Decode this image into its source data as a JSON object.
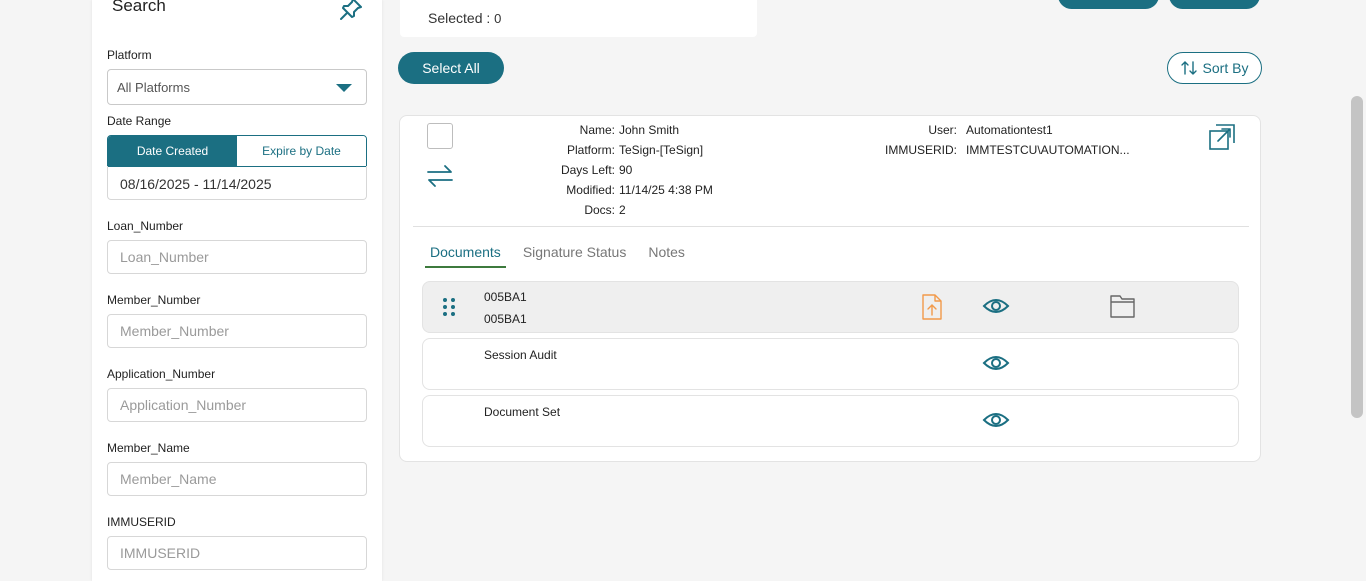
{
  "sidebar": {
    "title": "Search",
    "platform": {
      "label": "Platform",
      "value": "All Platforms"
    },
    "date_range": {
      "label": "Date Range",
      "options": [
        "Date Created",
        "Expire by Date"
      ],
      "value": "08/16/2025 - 11/14/2025"
    },
    "fields": [
      {
        "label": "Loan_Number",
        "placeholder": "Loan_Number"
      },
      {
        "label": "Member_Number",
        "placeholder": "Member_Number"
      },
      {
        "label": "Application_Number",
        "placeholder": "Application_Number"
      },
      {
        "label": "Member_Name",
        "placeholder": "Member_Name"
      },
      {
        "label": "IMMUSERID",
        "placeholder": "IMMUSERID"
      }
    ]
  },
  "selection": {
    "label": "Selected : ",
    "count": "0"
  },
  "toolbar": {
    "select_all": "Select All",
    "sort_by": "Sort By"
  },
  "record": {
    "left": [
      {
        "label": "Name:",
        "value": "John Smith"
      },
      {
        "label": "Platform:",
        "value": "TeSign-[TeSign]"
      },
      {
        "label": "Days Left:",
        "value": "90"
      },
      {
        "label": "Modified:",
        "value": "11/14/25 4:38 PM"
      },
      {
        "label": "Docs:",
        "value": "2"
      }
    ],
    "right": [
      {
        "label": "User:",
        "value": "Automationtest1"
      },
      {
        "label": "IMMUSERID:",
        "value": "IMMTESTCU\\AUTOMATION..."
      }
    ],
    "tabs": [
      "Documents",
      "Signature Status",
      "Notes"
    ],
    "documents": [
      {
        "line1": "005BA1",
        "line2": "005BA1"
      },
      {
        "line1": "Session Audit",
        "line2": ""
      },
      {
        "line1": "Document Set",
        "line2": ""
      }
    ]
  },
  "colors": {
    "accent": "#1b6f82",
    "upload": "#f29a4a",
    "tab_underline": "#3d7a3d"
  }
}
